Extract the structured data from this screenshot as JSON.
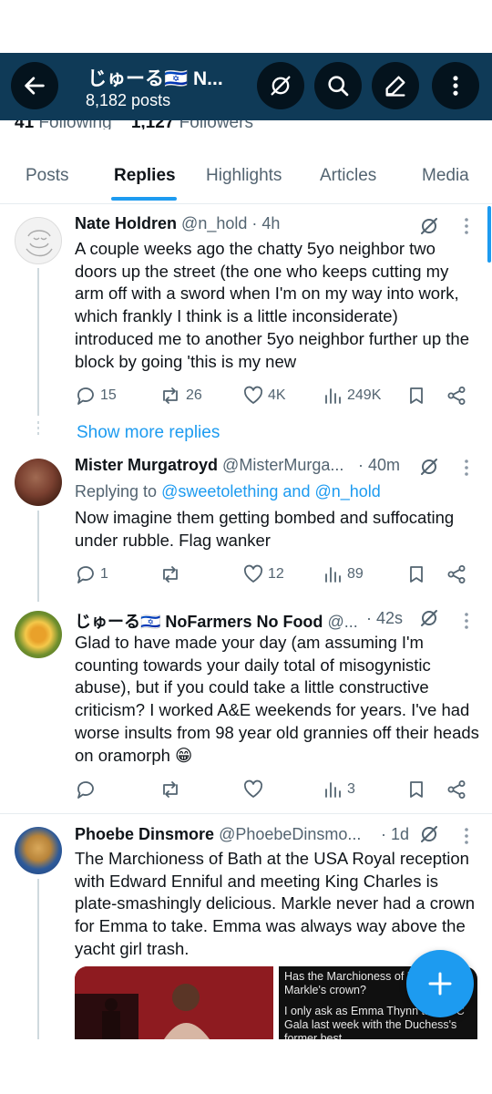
{
  "header": {
    "title": "じゅーる🇮🇱 N...",
    "subtitle": "8,182 posts",
    "following_count": "41",
    "following_label": "Following",
    "followers_count": "1,127",
    "followers_label": "Followers",
    "icons": [
      "back-arrow-icon",
      "grok-icon",
      "search-icon",
      "edit-icon",
      "more-vertical-icon"
    ]
  },
  "tabs": [
    {
      "label": "Posts"
    },
    {
      "label": "Replies",
      "active": true
    },
    {
      "label": "Highlights"
    },
    {
      "label": "Articles"
    },
    {
      "label": "Media"
    }
  ],
  "posts": [
    {
      "name": "Nate Holdren",
      "handle": "@n_hold",
      "time": "· 4h",
      "body": "A couple weeks ago the chatty 5yo neighbor two doors up the street (the one who keeps cutting my arm off with a sword when I'm on my way into work, which frankly I think is a little inconsiderate) introduced me to another 5yo neighbor further up the block by going 'this is my new",
      "replies": "15",
      "reposts": "26",
      "likes": "4K",
      "views": "249K"
    },
    {
      "show_more": "Show more replies"
    },
    {
      "name": "Mister Murgatroyd",
      "handle": "@MisterMurga...",
      "time": "· 40m",
      "replying_prefix": "Replying to",
      "replying_users": "@sweetolething and @n_hold",
      "body": "Now imagine them getting bombed and suffocating under rubble. Flag wanker",
      "replies": "1",
      "reposts": "",
      "likes": "12",
      "views": "89"
    },
    {
      "name": "じゅーる🇮🇱 NoFarmers No Food",
      "handle": "@...",
      "time": "· 42s",
      "body": "Glad to have made your day (am assuming I'm counting towards your daily total of misogynistic abuse), but if you could take a little constructive criticism? I worked A&E weekends for years. I've had worse insults from 98 year old grannies off their heads on oramorph 😁",
      "replies": "",
      "reposts": "",
      "likes": "",
      "views": "3"
    },
    {
      "name": "Phoebe Dinsmore",
      "handle": "@PhoebeDinsmo...",
      "time": "· 1d",
      "body": "The Marchioness of Bath at the USA Royal reception with Edward Enniful and meeting King Charles is plate-smashingly delicious. Markle never had a crown for Emma to take. Emma was always way above the yacht girl trash.",
      "media_right_line1": "Has the Marchioness of Meghan Markle's crown?",
      "media_right_line2": "I only ask as Emma Thynn the NYC Gala last week with the Duchess's former best..."
    }
  ],
  "colors": {
    "topbar": "#0f3a57",
    "accent": "#1d9bf0",
    "text": "#0f1419",
    "muted": "#536471"
  }
}
